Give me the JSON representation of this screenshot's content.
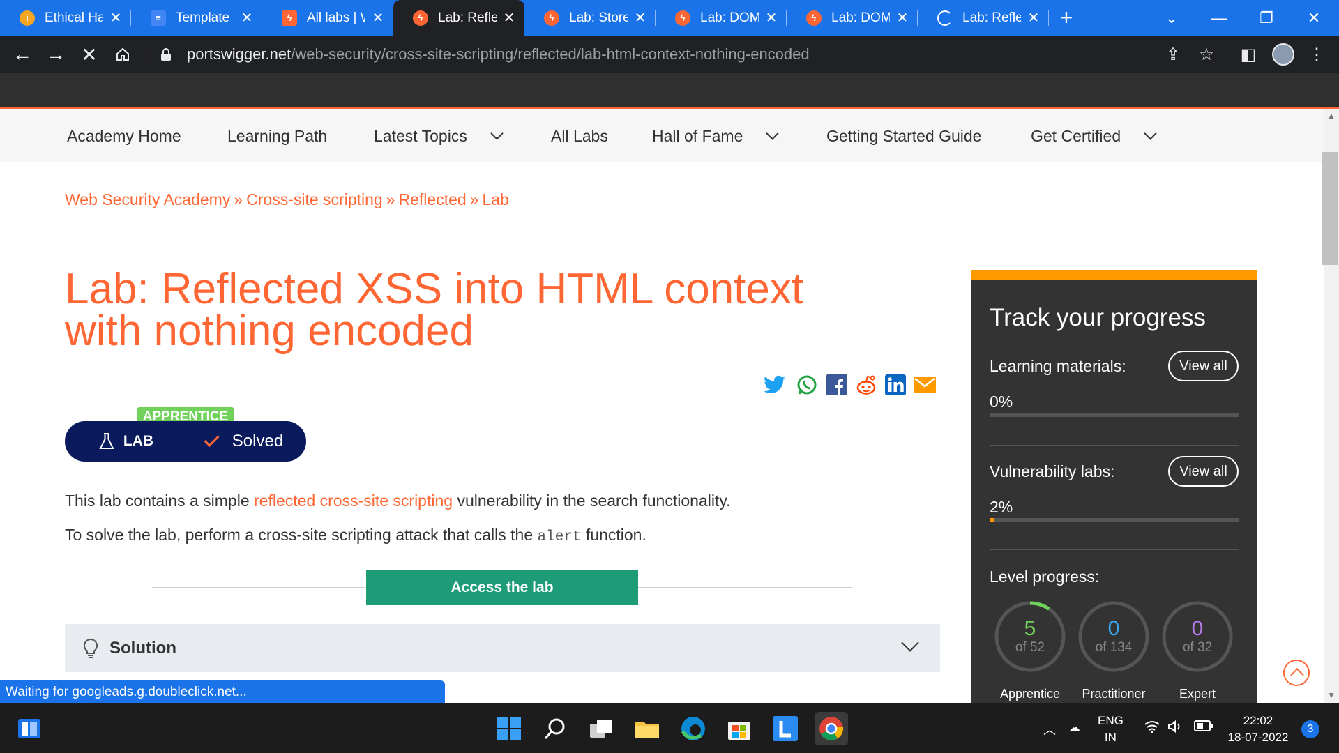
{
  "browser": {
    "tabs": [
      {
        "label": "Ethical Hac",
        "favicon_color": "#f5a623"
      },
      {
        "label": "Template - (",
        "favicon_color": "#4285f4"
      },
      {
        "label": "All labs | W",
        "favicon_color": "#ff6633"
      },
      {
        "label": "Lab: Reflect",
        "favicon_color": "#ff6633",
        "active": true
      },
      {
        "label": "Lab: Stored",
        "favicon_color": "#ff6633"
      },
      {
        "label": "Lab: DOM-",
        "favicon_color": "#ff6633"
      },
      {
        "label": "Lab: DOM-",
        "favicon_color": "#ff6633"
      },
      {
        "label": "Lab: Reflect",
        "favicon_color": "#1a73e8",
        "loading": true
      }
    ],
    "close_glyph": "✕",
    "new_tab_glyph": "+",
    "url_host": "portswigger.net",
    "url_path": "/web-security/cross-site-scripting/reflected/lab-html-context-nothing-encoded",
    "status_text": "Waiting for googleads.g.doubleclick.net..."
  },
  "nav": {
    "items": [
      {
        "label": "Academy Home",
        "dropdown": false
      },
      {
        "label": "Learning Path",
        "dropdown": false
      },
      {
        "label": "Latest Topics",
        "dropdown": true
      },
      {
        "label": "All Labs",
        "dropdown": false
      },
      {
        "label": "Hall of Fame",
        "dropdown": true
      },
      {
        "label": "Getting Started Guide",
        "dropdown": false
      },
      {
        "label": "Get Certified",
        "dropdown": true
      }
    ]
  },
  "breadcrumb": [
    "Web Security Academy",
    "Cross-site scripting",
    "Reflected",
    "Lab"
  ],
  "breadcrumb_sep": "»",
  "page": {
    "title": "Lab: Reflected XSS into HTML context with nothing encoded",
    "level_badge": "APPRENTICE",
    "lab_label": "LAB",
    "status_label": "Solved",
    "para1_before": "This lab contains a simple ",
    "para1_link": "reflected cross-site scripting",
    "para1_after": " vulnerability in the search functionality.",
    "para2_before": "To solve the lab, perform a cross-site scripting attack that calls the ",
    "para2_code": "alert",
    "para2_after": " function.",
    "access_button": "Access the lab",
    "solution_label": "Solution"
  },
  "share_icons": [
    "twitter-icon",
    "whatsapp-icon",
    "facebook-icon",
    "reddit-icon",
    "linkedin-icon",
    "email-icon"
  ],
  "progress": {
    "title": "Track your progress",
    "learning_label": "Learning materials:",
    "learning_pct": "0%",
    "learning_fraction": 0.0,
    "vuln_label": "Vulnerability labs:",
    "vuln_pct": "2%",
    "vuln_fraction": 0.02,
    "view_all": "View all",
    "level_label": "Level progress:",
    "levels": [
      {
        "name": "Apprentice",
        "done": "5",
        "total": "of 52",
        "fraction": 0.096,
        "color": "#70d15b"
      },
      {
        "name": "Practitioner",
        "done": "0",
        "total": "of 134",
        "fraction": 0.0,
        "color": "#3aa8f0"
      },
      {
        "name": "Expert",
        "done": "0",
        "total": "of 32",
        "fraction": 0.0,
        "color": "#b57bea"
      }
    ]
  },
  "taskbar": {
    "lang_top": "ENG",
    "lang_bottom": "IN",
    "time": "22:02",
    "date": "18-07-2022",
    "notifications": "3"
  }
}
